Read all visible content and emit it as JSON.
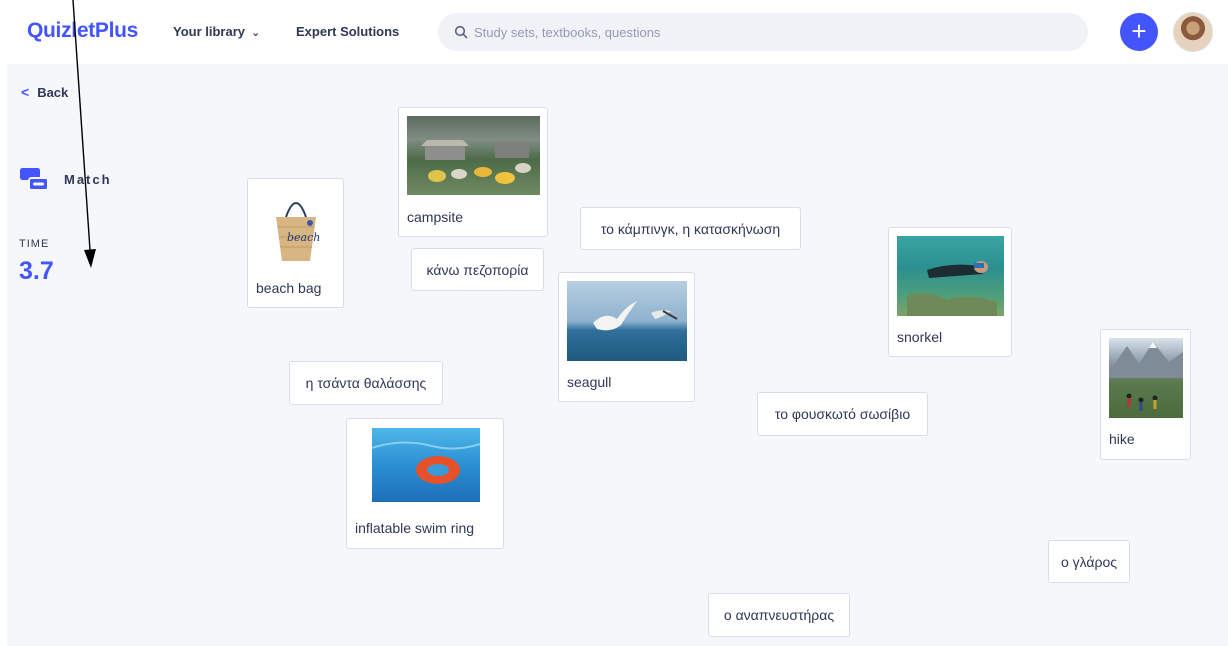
{
  "header": {
    "logo": "QuizletPlus",
    "library": "Your library",
    "expert": "Expert Solutions",
    "search_placeholder": "Study sets, textbooks, questions",
    "add_icon": "plus-icon",
    "accent": "#4255ff"
  },
  "sidebar": {
    "back": "Back",
    "mode": "Match",
    "time_label": "TIME",
    "time_value": "3.7"
  },
  "cards": {
    "campsite": "campsite",
    "beach_bag": "beach bag",
    "camping_gr": "το κάμπινγκ, η κατασκήνωση",
    "hike_gr": "κάνω πεζοπορία",
    "seagull": "seagull",
    "snorkel": "snorkel",
    "bag_gr": "η τσάντα θαλάσσης",
    "ring_gr": "το φουσκωτό σωσίβιο",
    "hike": "hike",
    "ring": "inflatable swim ring",
    "gull_gr": "ο γλάρος",
    "snorkel_gr": "ο αναπνευστήρας"
  }
}
